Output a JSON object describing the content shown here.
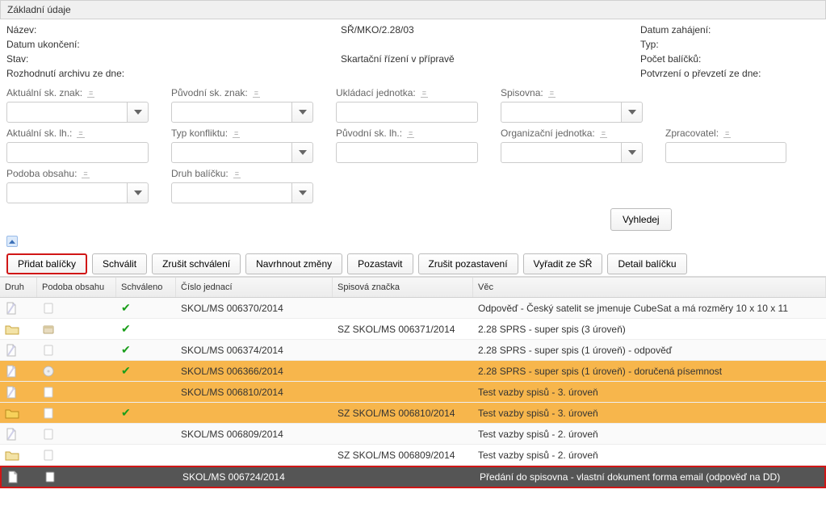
{
  "panel": {
    "title": "Základní údaje"
  },
  "info": {
    "nazev_label": "Název:",
    "nazev_value": "SŘ/MKO/2.28/03",
    "datum_zahajeni_label": "Datum zahájení:",
    "datum_ukonceni_label": "Datum ukončení:",
    "typ_label": "Typ:",
    "stav_label": "Stav:",
    "stav_value": "Skartační řízení v přípravě",
    "pocet_label": "Počet balíčků:",
    "rozhodnuti_label": "Rozhodnutí archivu ze dne:",
    "potvrzeni_label": "Potvrzení o převzetí ze dne:"
  },
  "filters": {
    "akt_sk_znak": "Aktuální sk. znak:",
    "puv_sk_znak": "Původní sk. znak:",
    "ukl_jednotka": "Ukládací jednotka:",
    "spisovna": "Spisovna:",
    "akt_sk_lh": "Aktuální sk. lh.:",
    "typ_konfliktu": "Typ konfliktu:",
    "puv_sk_lh": "Původní sk. lh.:",
    "org_jednotka": "Organizační jednotka:",
    "zpracovatel": "Zpracovatel:",
    "podoba_obsahu": "Podoba obsahu:",
    "druh_balicku": "Druh balíčku:",
    "eq": "="
  },
  "buttons": {
    "vyhledej": "Vyhledej",
    "pridat": "Přidat balíčky",
    "schvalit": "Schválit",
    "zrusit_schval": "Zrušit schválení",
    "navrhnout": "Navrhnout změny",
    "pozastavit": "Pozastavit",
    "zrusit_pozast": "Zrušit pozastavení",
    "vyradit": "Vyřadit ze SŘ",
    "detail": "Detail balíčku"
  },
  "grid": {
    "headers": {
      "druh": "Druh",
      "podoba": "Podoba obsahu",
      "schvaleno": "Schváleno",
      "cj": "Číslo jednací",
      "sz": "Spisová značka",
      "vec": "Věc"
    },
    "rows": [
      {
        "druh": "doc",
        "podoba": "page",
        "schvaleno": true,
        "cj": "SKOL/MS 006370/2014",
        "sz": "",
        "vec": "Odpověď - Český satelit se jmenuje CubeSat a má rozměry 10 x 10 x 11",
        "style": "alt"
      },
      {
        "druh": "folder",
        "podoba": "box",
        "schvaleno": true,
        "cj": "",
        "sz": "SZ SKOL/MS 006371/2014",
        "vec": "2.28 SPRS - super spis (3 úroveň)",
        "style": ""
      },
      {
        "druh": "doc",
        "podoba": "page",
        "schvaleno": true,
        "cj": "SKOL/MS 006374/2014",
        "sz": "",
        "vec": "2.28 SPRS - super spis (1 úroveň) - odpověď",
        "style": "alt"
      },
      {
        "druh": "doc",
        "podoba": "disc",
        "schvaleno": true,
        "cj": "SKOL/MS 006366/2014",
        "sz": "",
        "vec": "2.28 SPRS - super spis (1 úroveň) - doručená písemnost",
        "style": "orange"
      },
      {
        "druh": "doc",
        "podoba": "page",
        "schvaleno": false,
        "cj": "SKOL/MS 006810/2014",
        "sz": "",
        "vec": "Test vazby spisů - 3. úroveň",
        "style": "orange"
      },
      {
        "druh": "folder-y",
        "podoba": "page",
        "schvaleno": true,
        "cj": "",
        "sz": "SZ SKOL/MS 006810/2014",
        "vec": "Test vazby spisů - 3. úroveň",
        "style": "orange"
      },
      {
        "druh": "doc",
        "podoba": "page",
        "schvaleno": false,
        "cj": "SKOL/MS 006809/2014",
        "sz": "",
        "vec": "Test vazby spisů - 2. úroveň",
        "style": "alt"
      },
      {
        "druh": "folder",
        "podoba": "page",
        "schvaleno": false,
        "cj": "",
        "sz": "SZ SKOL/MS 006809/2014",
        "vec": "Test vazby spisů - 2. úroveň",
        "style": ""
      },
      {
        "druh": "doc-d",
        "podoba": "page-d",
        "schvaleno": false,
        "cj": "SKOL/MS 006724/2014",
        "sz": "",
        "vec": "Předání do spisovna - vlastní dokument forma email (odpověď na DD)",
        "style": "dark"
      }
    ]
  }
}
